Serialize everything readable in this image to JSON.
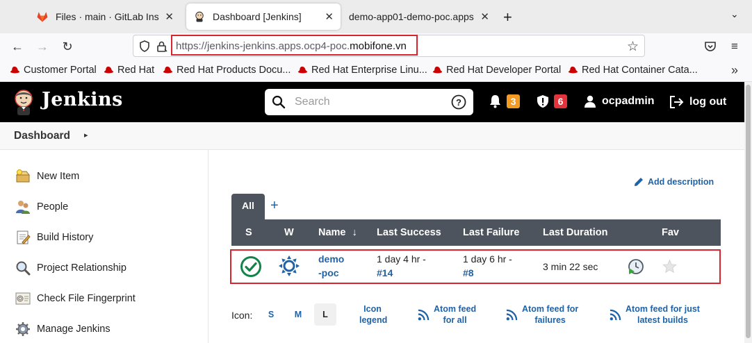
{
  "browser": {
    "tabs": [
      {
        "title": "Files · main · GitLab Instan",
        "active": false
      },
      {
        "title": "Dashboard [Jenkins]",
        "active": true
      },
      {
        "title": "demo-app01-demo-poc.apps",
        "active": false
      }
    ],
    "url_prefix": "https://jenkins-jenkins.apps.ocp4-poc.",
    "url_domain": "mobifone.vn",
    "bookmarks": [
      "Customer Portal",
      "Red Hat",
      "Red Hat Products Docu...",
      "Red Hat Enterprise Linu...",
      "Red Hat Developer Portal",
      "Red Hat Container Cata..."
    ]
  },
  "header": {
    "title": "Jenkins",
    "search_placeholder": "Search",
    "notifications_count": "3",
    "security_count": "6",
    "user": "ocpadmin",
    "logout": "log out"
  },
  "breadcrumb": {
    "label": "Dashboard"
  },
  "sidebar": {
    "items": [
      {
        "label": "New Item",
        "icon": "new-item-icon"
      },
      {
        "label": "People",
        "icon": "people-icon"
      },
      {
        "label": "Build History",
        "icon": "build-history-icon"
      },
      {
        "label": "Project Relationship",
        "icon": "project-relationship-icon"
      },
      {
        "label": "Check File Fingerprint",
        "icon": "fingerprint-icon"
      },
      {
        "label": "Manage Jenkins",
        "icon": "gear-icon"
      }
    ]
  },
  "main": {
    "add_description": "Add description",
    "view_tab": "All",
    "columns": [
      "S",
      "W",
      "Name",
      "Last Success",
      "Last Failure",
      "Last Duration",
      "Fav"
    ],
    "name_sort_arrow": "↓",
    "jobs": [
      {
        "name_line1": "demo",
        "name_line2": "-poc",
        "last_success": "1 day 4 hr -",
        "last_success_build": "#14",
        "last_failure": "1 day 6 hr -",
        "last_failure_build": "#8",
        "last_duration": "3 min 22 sec",
        "status": "success",
        "weather": "sunny"
      }
    ],
    "legend": {
      "icon_label": "Icon:",
      "sizes": [
        "S",
        "M",
        "L"
      ],
      "selected_size": "L",
      "icon_legend": [
        "Icon",
        "legend"
      ],
      "feeds": [
        [
          "Atom feed",
          "for all"
        ],
        [
          "Atom feed for",
          "failures"
        ],
        [
          "Atom feed for just",
          "latest builds"
        ]
      ]
    }
  },
  "colors": {
    "header_bg": "#000000",
    "table_header_bg": "#4d545d",
    "link": "#1f62a6",
    "highlight": "#d9232e",
    "notification_badge": "#f59a23",
    "security_badge": "#e3343d",
    "success": "#138347"
  }
}
